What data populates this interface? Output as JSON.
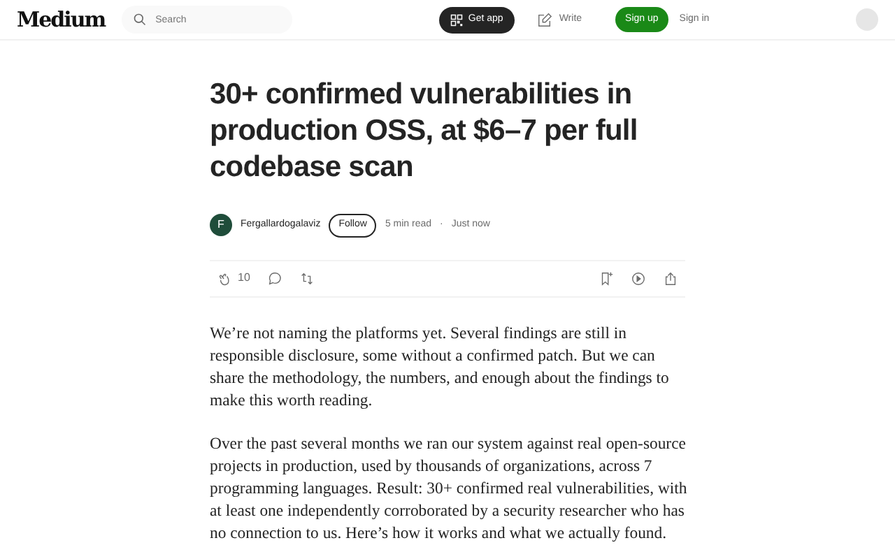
{
  "header": {
    "logo": "Medium",
    "search": {
      "placeholder": "Search"
    },
    "get_app": "Get app",
    "write": "Write",
    "sign_up": "Sign up",
    "sign_in": "Sign in"
  },
  "article": {
    "title": "30+ confirmed vulnerabilities in production OSS, at $6–7 per full codebase scan",
    "author": {
      "initial": "F",
      "name": "Fergallardogalaviz",
      "follow": "Follow",
      "read_time": "5 min read",
      "separator": "·",
      "published": "Just now"
    },
    "actions": {
      "claps": "10"
    },
    "paragraphs": [
      "We’re not naming the platforms yet. Several findings are still in responsible disclosure, some without a confirmed patch. But we can share the methodology, the numbers, and enough about the findings to make this worth reading.",
      "Over the past several months we ran our system against real open-source projects in production, used by thousands of organizations, across 7 programming languages. Result: 30+ confirmed real vulnerabilities, with at least one independently corroborated by a security researcher who has no connection to us. Here’s how it works and what we actually found."
    ]
  }
}
